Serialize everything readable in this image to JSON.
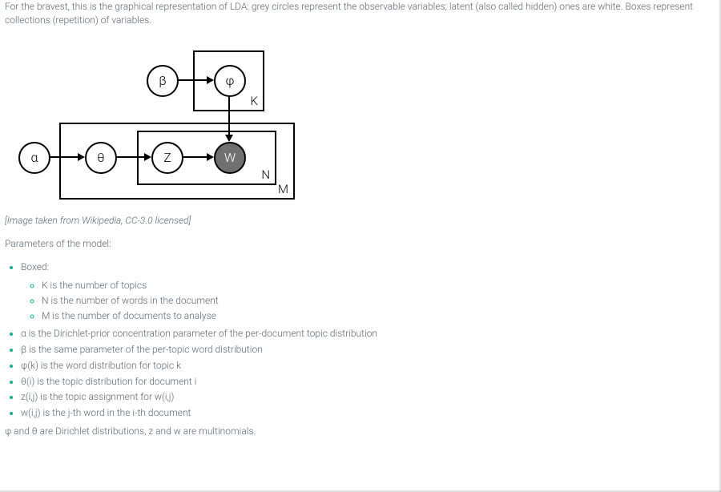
{
  "intro": "For the bravest, this is the graphical representation of LDA: grey circles represent the observable variables; latent (also called hidden) ones are white. Boxes represent collections (repetition) of variables.",
  "diagram": {
    "nodes": {
      "alpha": "α",
      "theta": "θ",
      "z": "Z",
      "w": "W",
      "beta": "β",
      "phi": "φ"
    },
    "plates": {
      "K": "K",
      "N": "N",
      "M": "M"
    }
  },
  "caption": "[Image taken from Wikipedia, CC-3.0 licensed]",
  "params_heading": "Parameters of the model:",
  "boxed_label": "Boxed:",
  "boxed_items": {
    "K": "K is the number of topics",
    "N": "N is the number of words in the document",
    "M": "M is the number of documents to analyse"
  },
  "params": {
    "alpha": "α is the Dirichlet-prior concentration parameter of the per-document topic distribution",
    "beta": "β is the same parameter of the per-topic word distribution",
    "phi": "φ(k) is the word distribution for topic k",
    "theta": "θ(i) is the topic distribution for document i",
    "z": "z(i,j) is the topic assignment for w(i,j)",
    "w": "w(i,j) is the j-th word in the i-th document"
  },
  "closing": "φ and θ are Dirichlet distributions, z and w are multinomials."
}
